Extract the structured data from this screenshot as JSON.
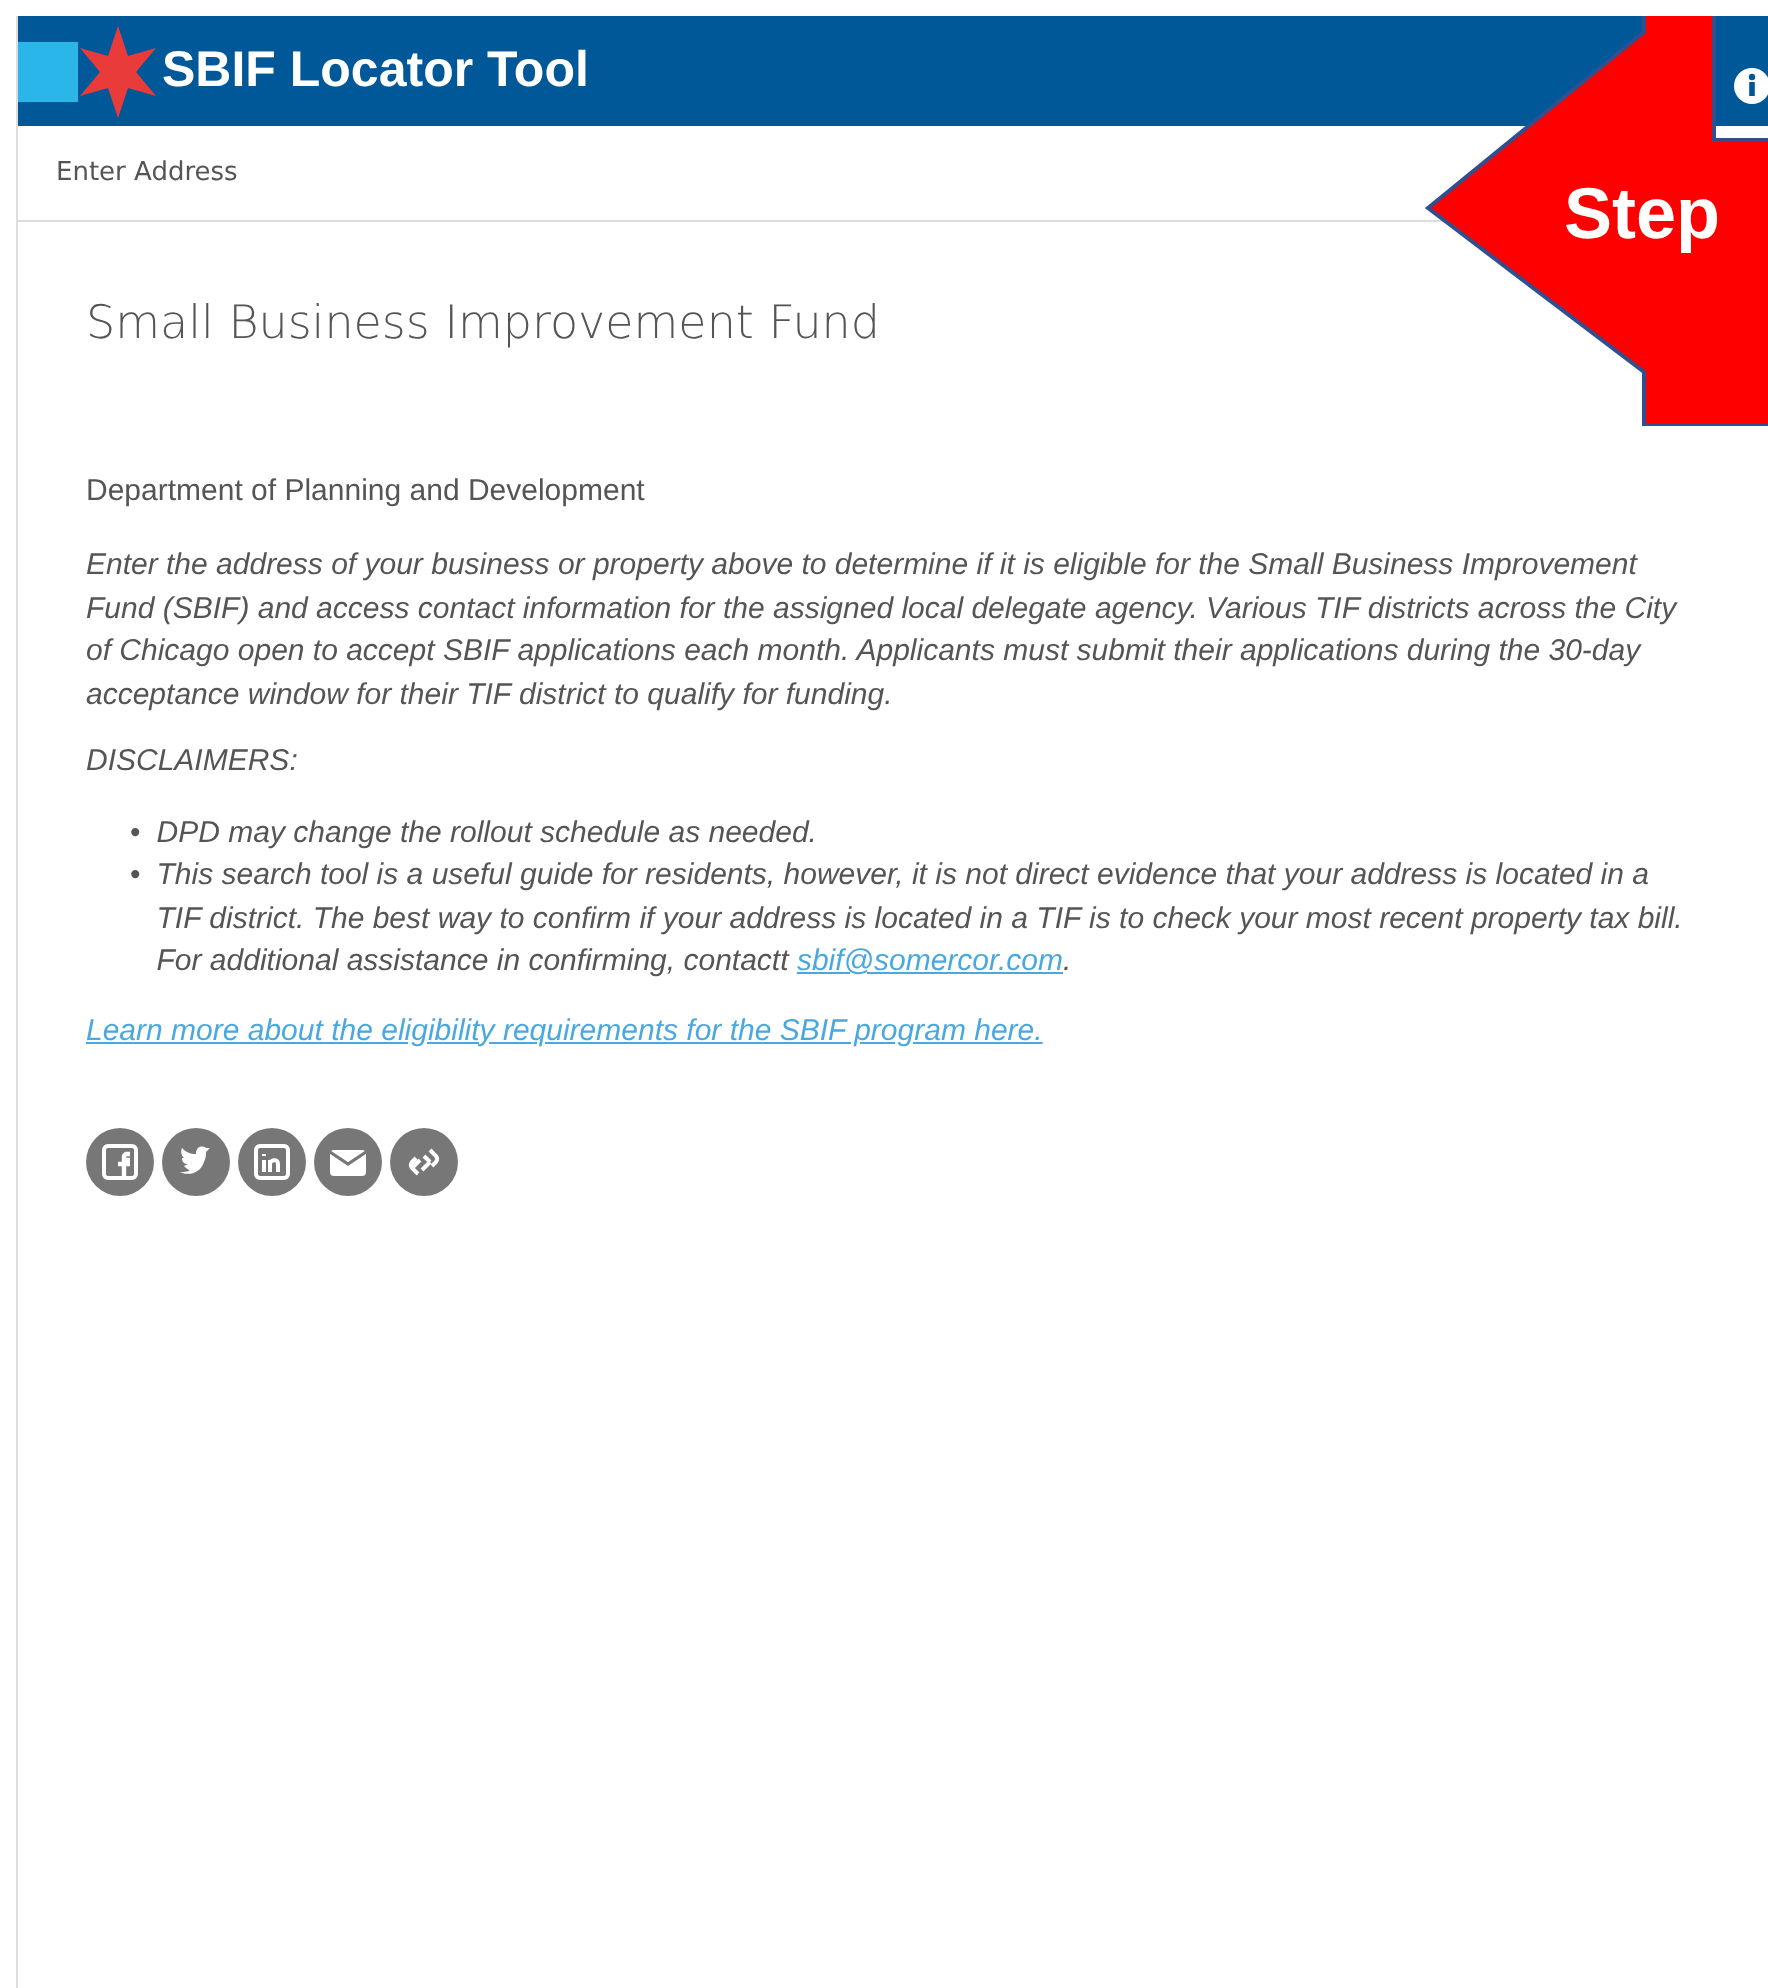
{
  "header": {
    "title": "SBIF Locator Tool"
  },
  "search": {
    "placeholder": "Enter Address"
  },
  "annotation": {
    "text": "Step"
  },
  "content": {
    "title": "Small Business Improvement Fund",
    "subtitle": "Department of Planning and Development",
    "intro": "Enter the address of your business or property above to determine if it is eligible for the Small Business Improvement Fund (SBIF) and access contact information for the assigned local delegate agency. Various TIF districts across the City of Chicago open to accept SBIF applications each month. Applicants must submit their applications during the 30-day acceptance window for their TIF district to qualify for funding.",
    "disclaimers_heading": "DISCLAIMERS:",
    "disclaimers": [
      {
        "marker": "•",
        "text": "DPD may change the rollout schedule as needed."
      },
      {
        "marker": "•",
        "text": "This search tool is a useful guide for residents, however, it is not direct evidence that your address is located in a TIF district. The best way to confirm if your address is located in a TIF is to check your most recent property tax bill. For additional assistance in confirming, contactt",
        "link": "sbif@somercor.com",
        "suffix": "."
      }
    ],
    "more_link": "Learn more about the eligibility requirements for the SBIF program here.",
    "share": [
      {
        "kind": "facebook"
      },
      {
        "kind": "twitter"
      },
      {
        "kind": "linkedin"
      },
      {
        "kind": "email"
      },
      {
        "kind": "link"
      }
    ]
  }
}
